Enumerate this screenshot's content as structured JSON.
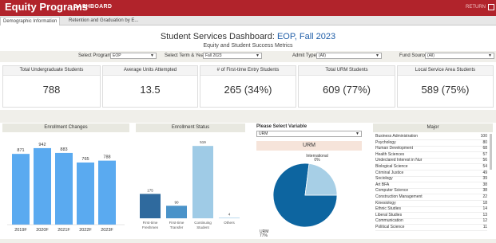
{
  "header": {
    "app_title": "Equity Programs",
    "nav_label": "DASHBOARD",
    "return_label": "RETURN"
  },
  "tabs": [
    {
      "label": "Demographic Information",
      "active": true
    },
    {
      "label": "Retention and Graduation by E...",
      "active": false
    }
  ],
  "dashboard": {
    "title_prefix": "Student Services Dashboard:",
    "title_program": "EOP,",
    "title_term": "Fall 2023",
    "subtitle": "Equity and Student Success Metrics"
  },
  "filters": {
    "program": {
      "label": "Select Program",
      "value": "EOP"
    },
    "term": {
      "label": "Select Term & Year",
      "value": "Fall 2023"
    },
    "admit": {
      "label": "Admit Type",
      "value": "(All)"
    },
    "fund": {
      "label": "Fund Source",
      "value": "(All)"
    }
  },
  "kpis": [
    {
      "label": "Total Undergraduate Students",
      "value": "788"
    },
    {
      "label": "Average Units Attempted",
      "value": "13.5"
    },
    {
      "label": "# of First-time Entry Students",
      "value": "265  (34%)"
    },
    {
      "label": "Total URM Students",
      "value": "609 (77%)"
    },
    {
      "label": "Local Service Area Students",
      "value": "589 (75%)"
    }
  ],
  "enrollment_changes": {
    "title": "Enrollment Changes"
  },
  "enrollment_status": {
    "title": "Enrollment Status"
  },
  "urm_panel": {
    "variable_label": "Please Select Variable",
    "variable_value": "URM",
    "title": "URM"
  },
  "major_panel": {
    "title": "Major",
    "rows": [
      {
        "name": "Business Administration",
        "count": "100"
      },
      {
        "name": "Psychology",
        "count": "80"
      },
      {
        "name": "Human Development",
        "count": "68"
      },
      {
        "name": "Health Sciences",
        "count": "57"
      },
      {
        "name": "Undeclared Interest in Nur",
        "count": "56"
      },
      {
        "name": "Biological Science",
        "count": "54"
      },
      {
        "name": "Criminal Justice",
        "count": "49"
      },
      {
        "name": "Sociology",
        "count": "39"
      },
      {
        "name": "Art BFA",
        "count": "38"
      },
      {
        "name": "Computer Science",
        "count": "38"
      },
      {
        "name": "Construction Management",
        "count": "22"
      },
      {
        "name": "Kinesiology",
        "count": "18"
      },
      {
        "name": "Ethnic Studies",
        "count": "14"
      },
      {
        "name": "Liberal Studies",
        "count": "13"
      },
      {
        "name": "Communication",
        "count": "12"
      },
      {
        "name": "Political Science",
        "count": "11"
      }
    ]
  },
  "colors": {
    "brand": "#b1232b",
    "bar_light": "#5aaaf0",
    "bar_dark": "#2f6a9e",
    "bar_mid": "#4a93c9",
    "bar_pale": "#9fcbe6",
    "pie_dark": "#0d65a0",
    "pie_light": "#a7cfe6"
  },
  "chart_data": [
    {
      "type": "bar",
      "title": "Enrollment Changes",
      "categories": [
        "2019F",
        "2020F",
        "2021F",
        "2022F",
        "2023F"
      ],
      "values": [
        871,
        942,
        883,
        765,
        788
      ],
      "ylim": [
        0,
        1000
      ]
    },
    {
      "type": "bar",
      "title": "Enrollment Status",
      "categories": [
        "First-time Freshmen",
        "First-time Transfer",
        "Continuing Student",
        "Others"
      ],
      "values": [
        175,
        90,
        519,
        4
      ],
      "ylim": [
        0,
        560
      ]
    },
    {
      "type": "pie",
      "title": "URM",
      "labels": [
        "URM",
        "International"
      ],
      "values": [
        77,
        23
      ],
      "label_texts": [
        "URM\n77%",
        "International\n0%"
      ]
    }
  ]
}
